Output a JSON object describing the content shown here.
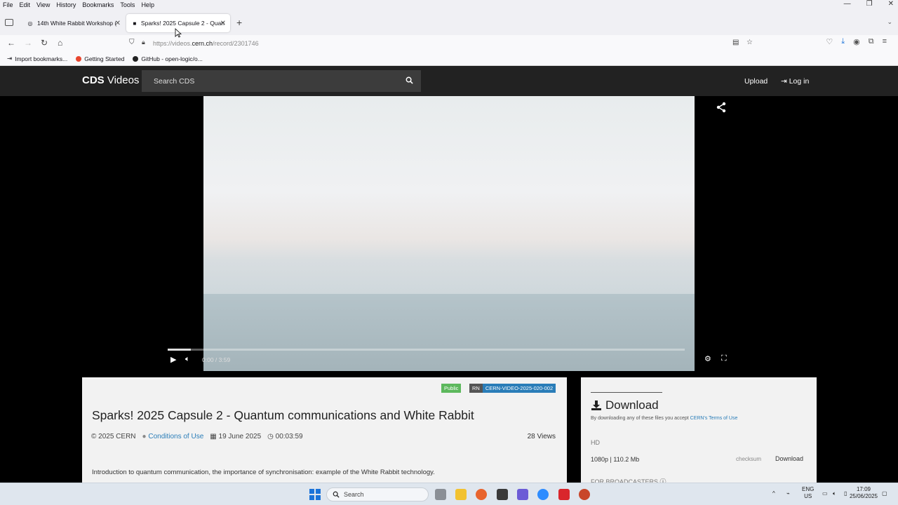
{
  "browser": {
    "menu": [
      "File",
      "Edit",
      "View",
      "History",
      "Bookmarks",
      "Tools",
      "Help"
    ],
    "tabs": [
      {
        "label": "14th White Rabbit Workshop (",
        "active": false
      },
      {
        "label": "Sparks! 2025 Capsule 2 - Quan",
        "active": true
      }
    ],
    "url_host": "https://videos.",
    "url_domain": "cern.ch",
    "url_path": "/record/2301746",
    "bookmarks": [
      "Import bookmarks...",
      "Getting Started",
      "GitHub - open-logic/o..."
    ]
  },
  "site": {
    "logo_bold": "CDS",
    "logo_rest": " Videos",
    "search_placeholder": "Search CDS",
    "upload": "Upload",
    "login": "Log in"
  },
  "player": {
    "time": "0:00 / 3:59",
    "progress": 0.0,
    "buffered": 0.045
  },
  "video": {
    "badge_public": "Public",
    "badge_rn_label": "RN",
    "badge_rn_value": "CERN-VIDEO-2025-020-002",
    "title": "Sparks! 2025 Capsule 2 - Quantum communications and White Rabbit",
    "copyright": "© 2025 CERN",
    "conditions": "Conditions of Use",
    "date": "19 June 2025",
    "duration": "00:03:59",
    "views": "28 Views",
    "description": "Introduction to quantum communication, the importance of synchronisation: example of the White Rabbit technology."
  },
  "download": {
    "title": "Download",
    "note_prefix": "By downloading any of these files you accept ",
    "note_link": "CERN's Terms of Use",
    "section_hd": "HD",
    "file_label": "1080p | 110.2 Mb",
    "checksum": "checksum",
    "button": "Download",
    "broadcasters": "FOR BROADCASTERS"
  },
  "taskbar": {
    "search": "Search",
    "lang_top": "ENG",
    "lang_bottom": "US",
    "time": "17:09",
    "date": "25/06/2025"
  }
}
